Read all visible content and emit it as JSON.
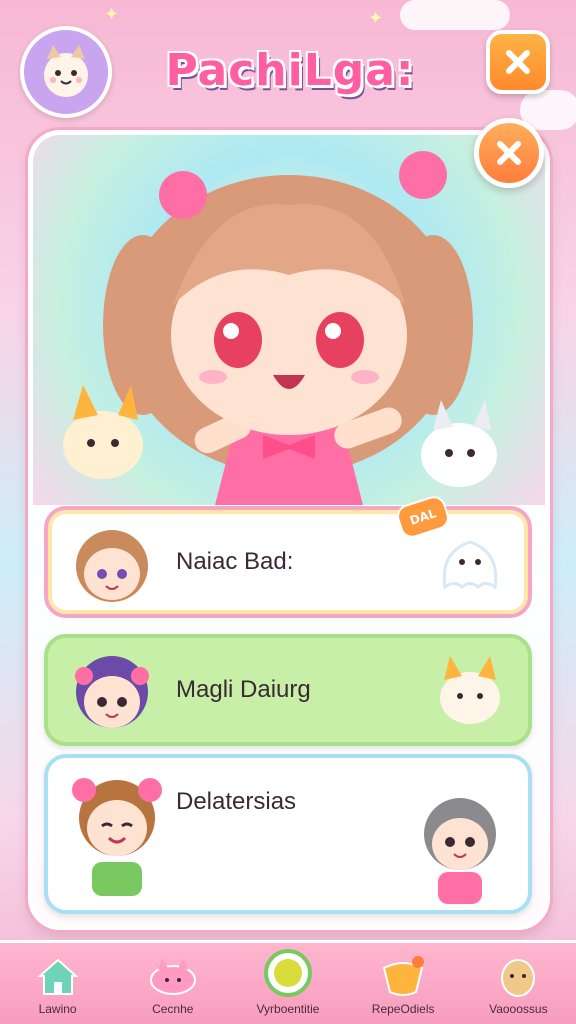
{
  "app": {
    "title": "PachiLga:"
  },
  "list": {
    "items": [
      {
        "label": "Naiac Bad:",
        "tag": "DAL"
      },
      {
        "label": "Magli Daiurg"
      },
      {
        "label": "Delatersias"
      }
    ]
  },
  "nav": {
    "items": [
      {
        "label": "Lawino",
        "icon": "house-icon"
      },
      {
        "label": "Cecnhe",
        "icon": "cat-cloud-icon"
      },
      {
        "label": "Vyrboentitie",
        "icon": "coin-icon"
      },
      {
        "label": "RepeOdiels",
        "icon": "candy-icon"
      },
      {
        "label": "Vaooossus",
        "icon": "character-icon"
      }
    ]
  },
  "colors": {
    "accent": "#ff5fa2",
    "orange": "#ff8a2b",
    "green": "#c8efa8",
    "blue": "#a9dff3"
  }
}
